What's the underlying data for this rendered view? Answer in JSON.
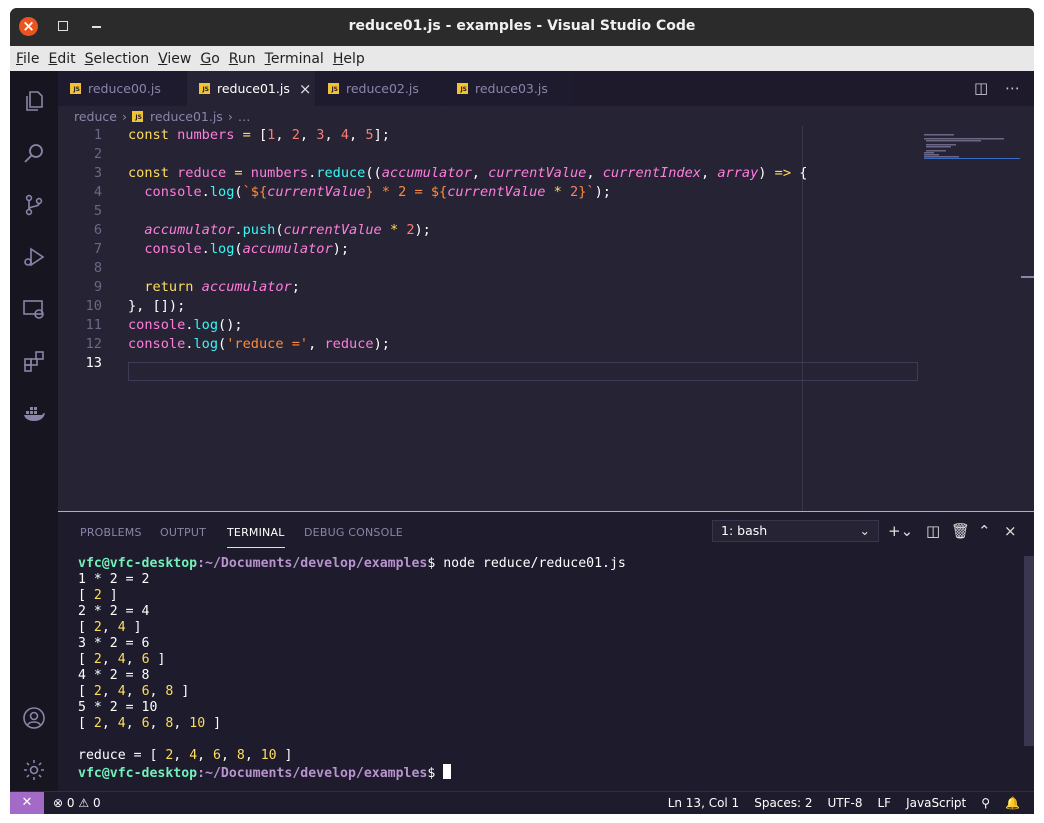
{
  "window": {
    "title": "reduce01.js - examples - Visual Studio Code"
  },
  "menu": [
    "File",
    "Edit",
    "Selection",
    "View",
    "Go",
    "Run",
    "Terminal",
    "Help"
  ],
  "menu_underline": [
    "F",
    "E",
    "S",
    "V",
    "G",
    "R",
    "T",
    "H"
  ],
  "menu_rest": [
    "ile",
    "dit",
    "election",
    "iew",
    "o",
    "un",
    "erminal",
    "elp"
  ],
  "tabs": [
    {
      "label": "reduce00.js",
      "active": false
    },
    {
      "label": "reduce01.js",
      "active": true
    },
    {
      "label": "reduce02.js",
      "active": false
    },
    {
      "label": "reduce03.js",
      "active": false
    }
  ],
  "breadcrumb": {
    "folder": "reduce",
    "file": "reduce01.js",
    "more": "…"
  },
  "editor": {
    "line_numbers": [
      "1",
      "2",
      "3",
      "4",
      "5",
      "6",
      "7",
      "8",
      "9",
      "10",
      "11",
      "12",
      "13"
    ],
    "current_line": "13"
  },
  "panel": {
    "tabs": [
      "PROBLEMS",
      "OUTPUT",
      "TERMINAL",
      "DEBUG CONSOLE"
    ],
    "active_tab": "TERMINAL",
    "terminal_select": "1: bash"
  },
  "terminal": {
    "user": "vfc@vfc-desktop",
    "path": ":~/Documents/develop/examples",
    "command": "$ node reduce/reduce01.js",
    "prompt_end": "$ "
  },
  "status": {
    "errors": "0",
    "warnings": "0",
    "position": "Ln 13, Col 1",
    "spaces": "Spaces: 2",
    "encoding": "UTF-8",
    "eol": "LF",
    "language": "JavaScript"
  },
  "icons": [
    "files-icon",
    "search-icon",
    "source-control-icon",
    "run-debug-icon",
    "remote-explorer-icon",
    "extensions-icon",
    "docker-icon",
    "account-icon",
    "settings-gear-icon"
  ],
  "colors": {
    "accent": "#ff7edb",
    "keyword": "#fede5d",
    "function": "#36f9f6",
    "number": "#f97e72",
    "string": "#ff8b39",
    "remote": "#a36ac7"
  }
}
